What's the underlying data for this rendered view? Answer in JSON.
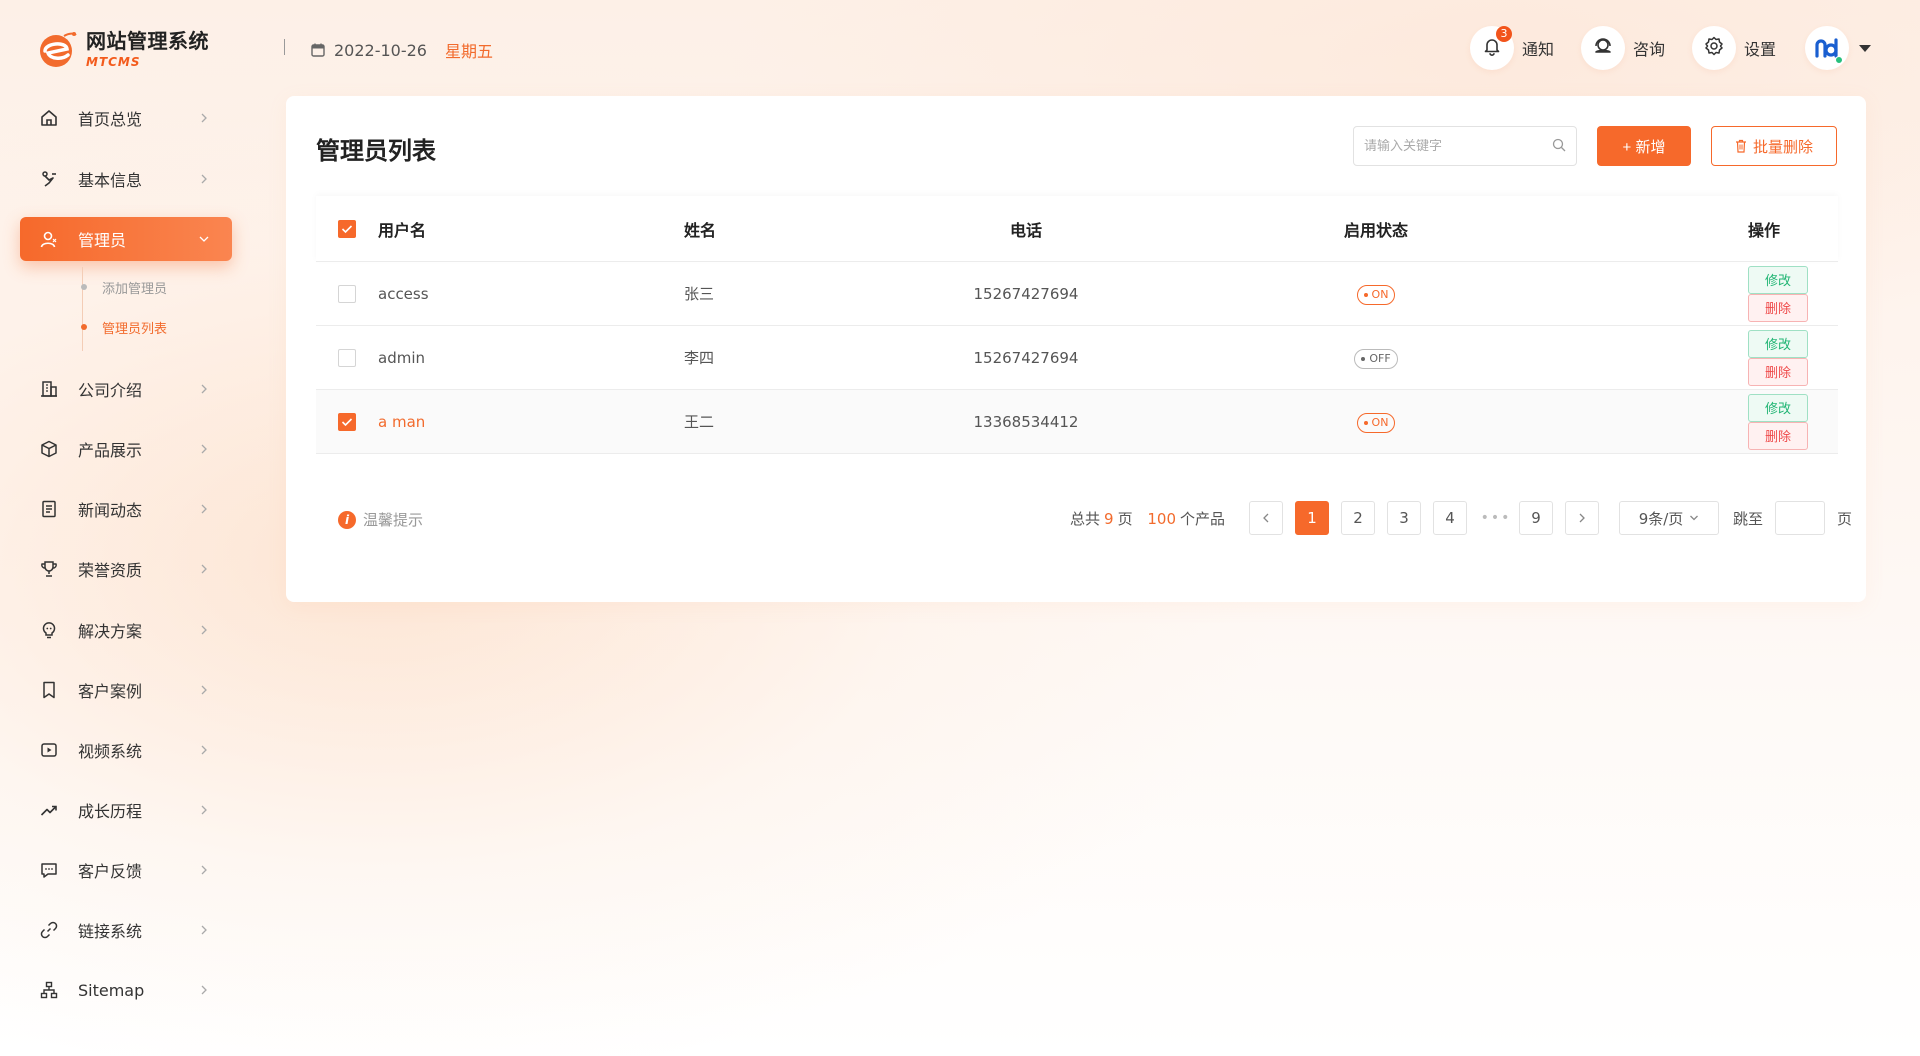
{
  "header": {
    "app_title": "网站管理系统",
    "app_subtitle": "MTCMS",
    "date": "2022-10-26",
    "weekday": "星期五",
    "notify_label": "通知",
    "notify_count": "3",
    "consult_label": "咨询",
    "settings_label": "设置"
  },
  "sidebar": {
    "items": [
      {
        "label": "首页总览",
        "icon": "home-icon"
      },
      {
        "label": "基本信息",
        "icon": "info-link-icon"
      },
      {
        "label": "管理员",
        "icon": "user-icon",
        "active": true
      },
      {
        "label": "公司介绍",
        "icon": "building-icon"
      },
      {
        "label": "产品展示",
        "icon": "box-icon"
      },
      {
        "label": "新闻动态",
        "icon": "news-icon"
      },
      {
        "label": "荣誉资质",
        "icon": "trophy-icon"
      },
      {
        "label": "解决方案",
        "icon": "bulb-icon"
      },
      {
        "label": "客户案例",
        "icon": "bookmark-icon"
      },
      {
        "label": "视频系统",
        "icon": "video-icon"
      },
      {
        "label": "成长历程",
        "icon": "trend-icon"
      },
      {
        "label": "客户反馈",
        "icon": "message-icon"
      },
      {
        "label": "链接系统",
        "icon": "link-icon"
      },
      {
        "label": "Sitemap",
        "icon": "sitemap-icon"
      }
    ],
    "sub_items": [
      {
        "label": "添加管理员"
      },
      {
        "label": "管理员列表",
        "active": true
      }
    ]
  },
  "main": {
    "title": "管理员列表",
    "search_placeholder": "请输入关键字",
    "add_label": "+ 新增",
    "batch_delete_label": "批量删除",
    "columns": [
      "用户名",
      "姓名",
      "电话",
      "启用状态",
      "操作"
    ],
    "rows": [
      {
        "username": "access",
        "name": "张三",
        "phone": "15267427694",
        "status": "ON",
        "checked": false
      },
      {
        "username": "admin",
        "name": "李四",
        "phone": "15267427694",
        "status": "OFF",
        "checked": false
      },
      {
        "username": "a man",
        "name": "王二",
        "phone": "13368534412",
        "status": "ON",
        "checked": true
      }
    ],
    "edit_label": "修改",
    "delete_label": "删除",
    "tip_label": "温馨提示"
  },
  "pagination": {
    "total_prefix": "总共",
    "total_pages": "9",
    "pages_unit": "页",
    "total_items": "100",
    "items_unit": "个产品",
    "pages": [
      "1",
      "2",
      "3",
      "4",
      "9"
    ],
    "ellipsis": "•••",
    "current": "1",
    "page_size": "9条/页",
    "jump_label": "跳至",
    "jump_unit": "页"
  },
  "colors": {
    "accent": "#f6692b",
    "success": "#21b574",
    "danger": "#ef4a4a"
  }
}
